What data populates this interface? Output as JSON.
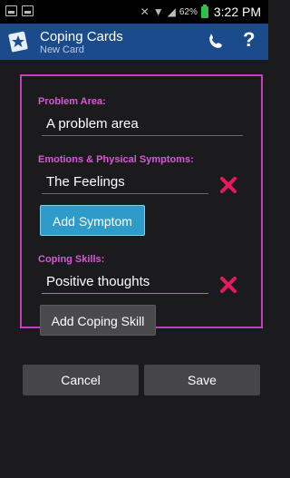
{
  "status_bar": {
    "battery": "62%",
    "time": "3:22 PM"
  },
  "action_bar": {
    "title": "Coping Cards",
    "subtitle": "New Card"
  },
  "form": {
    "problem_area": {
      "label": "Problem Area:",
      "value": "A problem area"
    },
    "emotions": {
      "label": "Emotions & Physical Symptoms:",
      "value": "The Feelings",
      "add_button": "Add Symptom"
    },
    "coping": {
      "label": "Coping Skills:",
      "value": "Positive thoughts",
      "add_button": "Add Coping Skill"
    }
  },
  "footer": {
    "cancel": "Cancel",
    "save": "Save"
  },
  "colors": {
    "accent": "#d857d4",
    "action_bar": "#1c4b8c",
    "delete": "#e8185c"
  }
}
